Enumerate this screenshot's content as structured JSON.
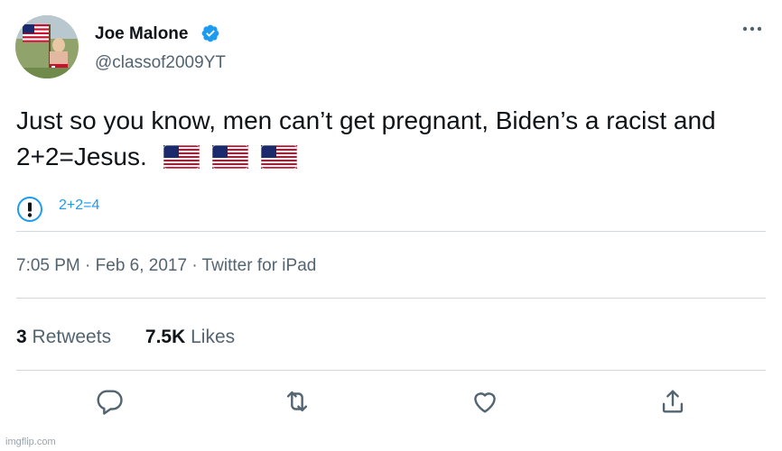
{
  "author": {
    "display_name": "Joe Malone",
    "handle": "@classof2009YT",
    "verified": true
  },
  "tweet": {
    "text": "Just so you know, men can’t get pregnant, Biden’s a racist and 2+2=Jesus.",
    "emoji": [
      "us-flag",
      "us-flag",
      "us-flag"
    ]
  },
  "notice": {
    "text": "2+2=4"
  },
  "meta": {
    "time": "7:05 PM",
    "date": "Feb 6, 2017",
    "source": "Twitter for iPad",
    "separator": "·"
  },
  "stats": {
    "retweets_count": "3",
    "retweets_label": "Retweets",
    "likes_count": "7.5K",
    "likes_label": "Likes"
  },
  "actions": [
    "reply-icon",
    "retweet-icon",
    "like-icon",
    "share-icon"
  ],
  "watermark": "imgflip.com",
  "colors": {
    "accent": "#1d9bf0",
    "text": "#0f1419",
    "secondary": "#536471",
    "divider": "#cfd9de"
  }
}
